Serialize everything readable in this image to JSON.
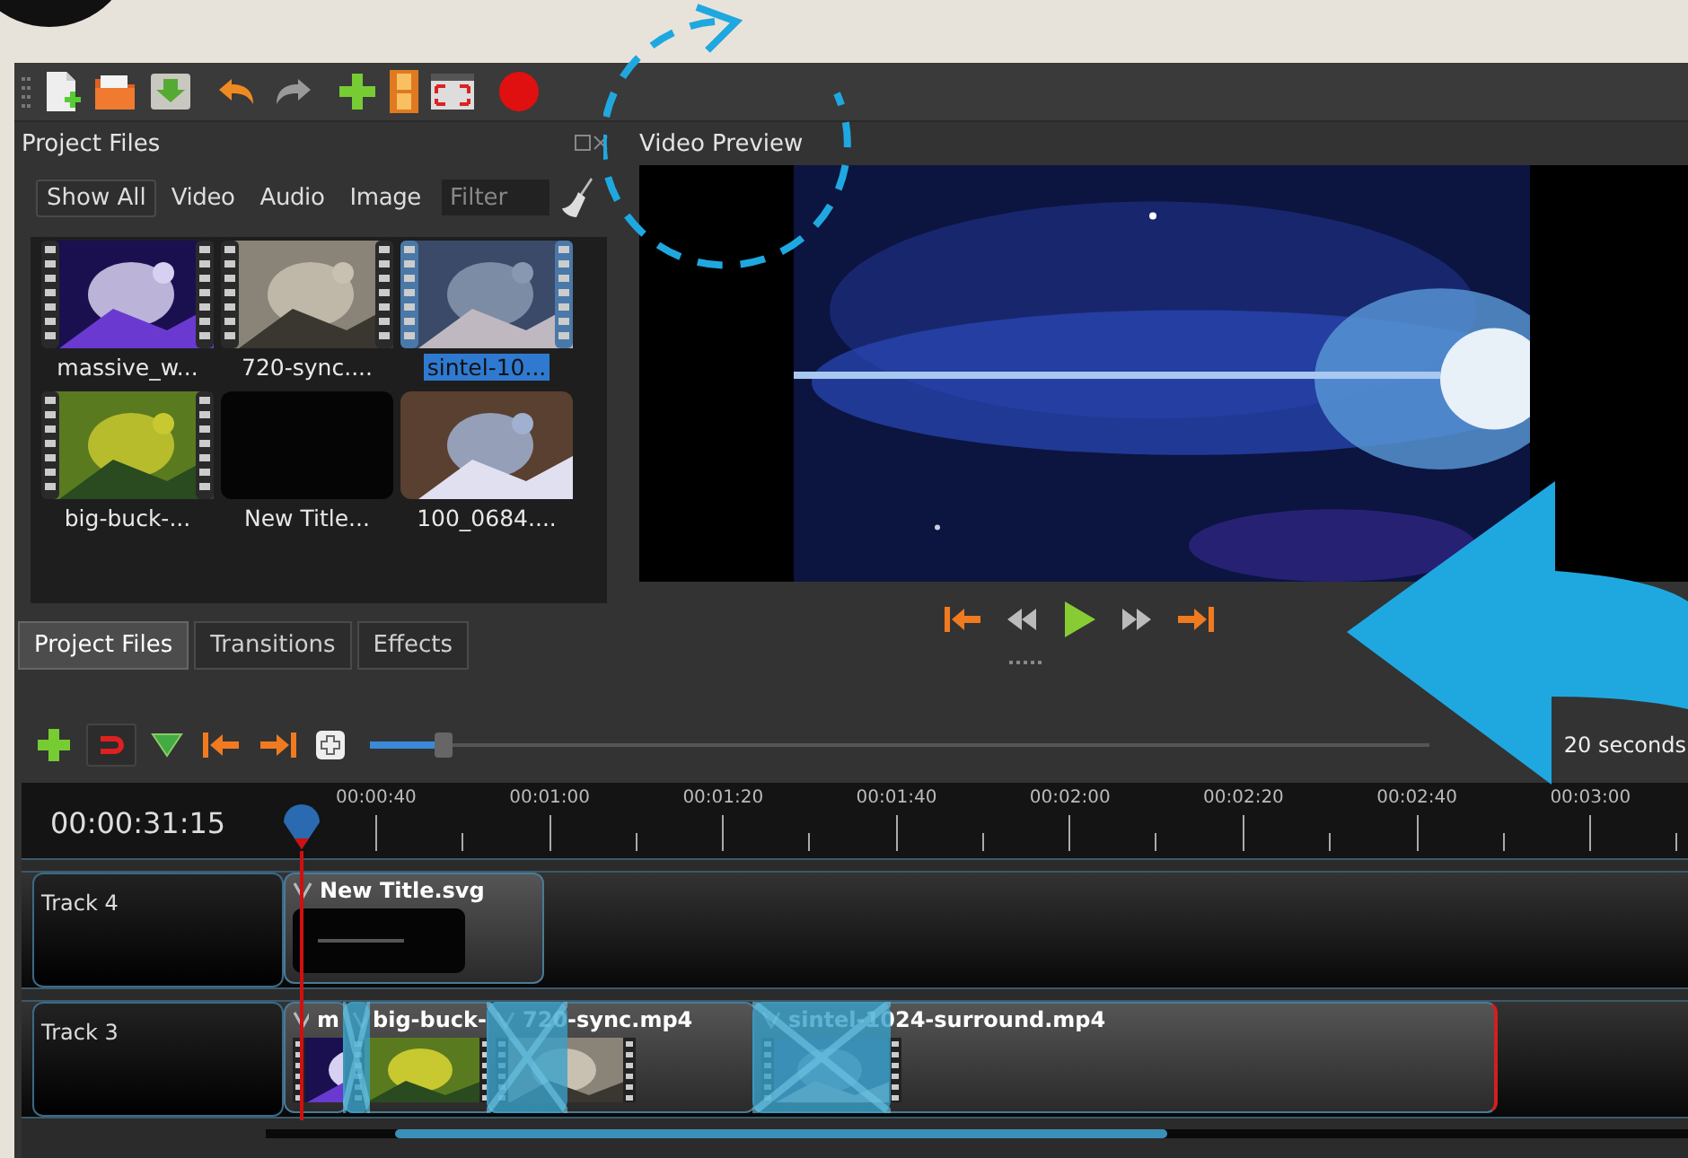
{
  "project_files": {
    "title": "Project Files",
    "filters": [
      {
        "label": "Show All",
        "selected": true
      },
      {
        "label": "Video",
        "selected": false
      },
      {
        "label": "Audio",
        "selected": false
      },
      {
        "label": "Image",
        "selected": false
      }
    ],
    "filter_field": {
      "placeholder": "Filter"
    },
    "files": [
      {
        "name": "massive_w...",
        "kind": "video",
        "selected": false
      },
      {
        "name": "720-sync....",
        "kind": "video",
        "selected": false
      },
      {
        "name": "sintel-10...",
        "kind": "video",
        "selected": true
      },
      {
        "name": "big-buck-...",
        "kind": "video",
        "selected": false
      },
      {
        "name": "New Title...",
        "kind": "title",
        "selected": false
      },
      {
        "name": "100_0684....",
        "selected": false
      }
    ]
  },
  "video_preview": {
    "title": "Video Preview"
  },
  "dock_tabs": [
    {
      "label": "Project Files",
      "selected": true
    },
    {
      "label": "Transitions",
      "selected": false
    },
    {
      "label": "Effects",
      "selected": false
    }
  ],
  "timeline": {
    "zoom": {
      "level": 0.07,
      "label": "20 seconds"
    },
    "timecode": "00:00:31:15",
    "ruler": [
      "00:00:40",
      "00:01:00",
      "00:01:20",
      "00:01:40",
      "00:02:00",
      "00:02:20",
      "00:02:40",
      "00:03:00"
    ],
    "tracks": [
      {
        "name": "Track 4",
        "clips": [
          {
            "title": "New Title.svg",
            "kind": "title"
          }
        ]
      },
      {
        "name": "Track 3",
        "clips": [
          {
            "title": "m",
            "kind": "video"
          },
          {
            "title": "big-buck-",
            "kind": "video"
          },
          {
            "title": "720-sync.mp4",
            "kind": "video"
          },
          {
            "title": "sintel-1024-surround.mp4",
            "kind": "video"
          }
        ]
      }
    ]
  }
}
